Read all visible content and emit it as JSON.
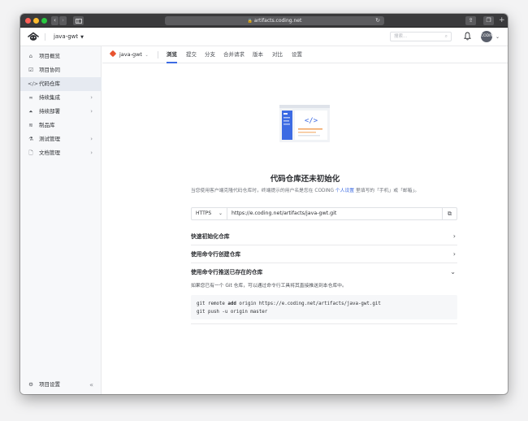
{
  "browser": {
    "url": "artifacts.coding.net"
  },
  "header": {
    "project_name": "java-gwt",
    "search_placeholder": "搜索...",
    "avatar_text": "CODING"
  },
  "sidebar": {
    "items": [
      {
        "label": "项目概览",
        "icon": "home-icon",
        "has_arrow": false,
        "active": false
      },
      {
        "label": "项目协同",
        "icon": "checkbox-icon",
        "has_arrow": false,
        "active": false
      },
      {
        "label": "代码仓库",
        "icon": "code-icon",
        "has_arrow": false,
        "active": true
      },
      {
        "label": "持续集成",
        "icon": "infinity-icon",
        "has_arrow": true,
        "active": false
      },
      {
        "label": "持续部署",
        "icon": "rocket-icon",
        "has_arrow": true,
        "active": false
      },
      {
        "label": "制品库",
        "icon": "layers-icon",
        "has_arrow": false,
        "active": false
      },
      {
        "label": "测试管理",
        "icon": "flask-icon",
        "has_arrow": true,
        "active": false
      },
      {
        "label": "文档管理",
        "icon": "document-icon",
        "has_arrow": true,
        "active": false
      }
    ],
    "settings_label": "项目设置"
  },
  "subnav": {
    "repo": "java-gwt",
    "tabs": [
      "浏览",
      "提交",
      "分支",
      "合并请求",
      "版本",
      "对比",
      "设置"
    ],
    "active_tab": 0
  },
  "empty_state": {
    "title": "代码仓库还未初始化",
    "hint_before": "当您使用客户端克隆代码仓库时，终端提示的用户名是您在 CODING ",
    "hint_link": "个人设置",
    "hint_after": " 里填写的「手机」或「邮箱」。"
  },
  "clone": {
    "protocol": "HTTPS",
    "url": "https://e.coding.net/artifacts/java-gwt.git"
  },
  "sections": [
    {
      "title": "快速初始化仓库",
      "expanded": false
    },
    {
      "title": "使用命令行创建仓库",
      "expanded": false
    },
    {
      "title": "使用命令行推送已存在的仓库",
      "expanded": true,
      "description": "如果您已有一个 Git 仓库，可以通过命令行工具将其直接推送到本仓库中。",
      "code_line1_pre": "git remote ",
      "code_line1_kw": "add",
      "code_line1_post": " origin https://e.coding.net/artifacts/java-gwt.git",
      "code_line2": "git push -u origin master"
    }
  ],
  "colors": {
    "accent": "#3d6be3",
    "git_brand": "#e8532f",
    "sidebar_active_bg": "#e6eaf1"
  }
}
